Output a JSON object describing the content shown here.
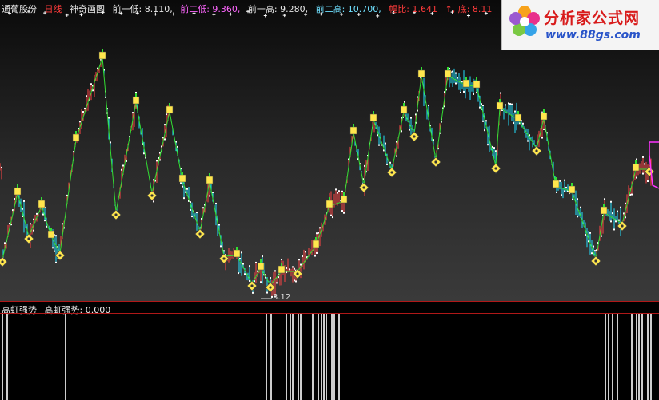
{
  "header": {
    "stock": "通葡股份",
    "period": "日线",
    "indicator": "神奇画图",
    "prev_low1": "前一低: 8.110,",
    "prev_low2": "前二低: 9.360,",
    "prev_high1": "前一高: 9.280,",
    "prev_high2": "前二高: 10.700,",
    "ratio": "幅比: 1.641",
    "bottom": "↑, 底: 8.11"
  },
  "sub_header": {
    "name": "高虹强势",
    "value_label": "高虹强势: 0.000"
  },
  "low_marker": "3.12",
  "logo": {
    "title": "分析家公式网",
    "url": "www.88gs.com"
  },
  "colors": {
    "up_line": "#ff4444",
    "down_line": "#22e0ff",
    "white_marks": "#ffffff",
    "zigzag": "#33dd33",
    "marker_fill": "#ffe64d",
    "magenta": "#ff33ff",
    "divider": "#b01818"
  },
  "chart_data": {
    "type": "line",
    "title": "",
    "price_min": 3.12,
    "zigzag_x": [
      3,
      22,
      36,
      52,
      64,
      75,
      95,
      128,
      145,
      170,
      190,
      212,
      228,
      250,
      262,
      280,
      296,
      315,
      326,
      338,
      352,
      372,
      395,
      412,
      430,
      442,
      455,
      467,
      490,
      505,
      518,
      527,
      545,
      560,
      583,
      596,
      620,
      625,
      648,
      671,
      680,
      695,
      715,
      745,
      755,
      778,
      795,
      812
    ],
    "zigzag_y": [
      325,
      242,
      296,
      258,
      296,
      317,
      175,
      72,
      266,
      128,
      242,
      140,
      226,
      290,
      228,
      321,
      320,
      355,
      336,
      357,
      340,
      340,
      308,
      258,
      252,
      166,
      232,
      150,
      213,
      140,
      168,
      95,
      200,
      95,
      107,
      108,
      208,
      135,
      150,
      186,
      148,
      233,
      240,
      324,
      266,
      280,
      212,
      212
    ],
    "sub_pulses_x": [
      3,
      9,
      82,
      333,
      339,
      358,
      363,
      366,
      373,
      376,
      391,
      398,
      402,
      405,
      408,
      415,
      418,
      424,
      757,
      761,
      766,
      772,
      790,
      796,
      799,
      803,
      810,
      814
    ]
  }
}
